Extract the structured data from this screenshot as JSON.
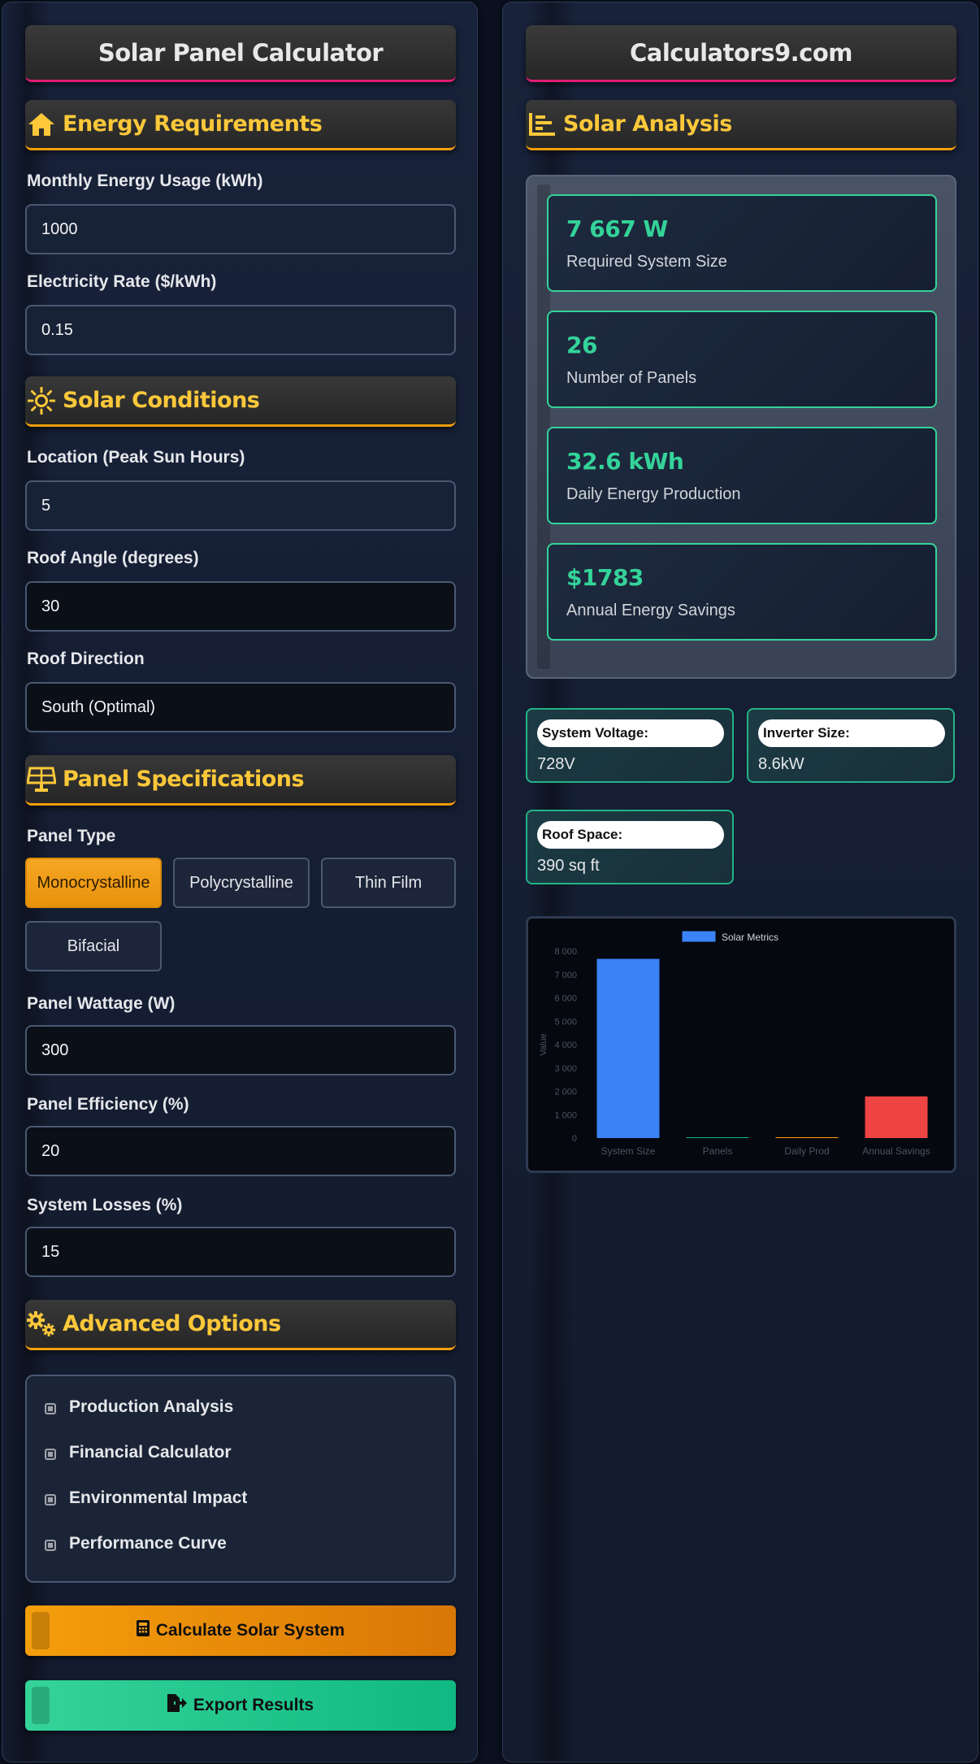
{
  "left": {
    "title": "Solar Panel Calculator",
    "sections": {
      "energy": "Energy Requirements",
      "solar": "Solar Conditions",
      "panel": "Panel Specifications",
      "advanced": "Advanced Options"
    },
    "fields": {
      "monthly_usage": {
        "label": "Monthly Energy Usage (kWh)",
        "value": "1000"
      },
      "rate": {
        "label": "Electricity Rate ($/kWh)",
        "value": "0.15"
      },
      "sun_hours": {
        "label": "Location (Peak Sun Hours)",
        "value": "5"
      },
      "roof_angle": {
        "label": "Roof Angle (degrees)",
        "value": "30"
      },
      "roof_direction": {
        "label": "Roof Direction",
        "value": "South (Optimal)"
      },
      "panel_type_label": "Panel Type",
      "panel_wattage": {
        "label": "Panel Wattage (W)",
        "value": "300"
      },
      "panel_efficiency": {
        "label": "Panel Efficiency (%)",
        "value": "20"
      },
      "system_losses": {
        "label": "System Losses (%)",
        "value": "15"
      }
    },
    "panel_types": [
      "Monocrystalline",
      "Polycrystalline",
      "Thin Film",
      "Bifacial"
    ],
    "panel_type_selected": "Monocrystalline",
    "advanced_options": [
      "Production Analysis",
      "Financial Calculator",
      "Environmental Impact",
      "Performance Curve"
    ],
    "buttons": {
      "calculate": "Calculate Solar System",
      "export": "Export Results"
    }
  },
  "right": {
    "title": "Calculators9.com",
    "section": "Solar Analysis",
    "results": [
      {
        "value": "7 667 W",
        "caption": "Required System Size"
      },
      {
        "value": "26",
        "caption": "Number of Panels"
      },
      {
        "value": "32.6 kWh",
        "caption": "Daily Energy Production"
      },
      {
        "value": "$1783",
        "caption": "Annual Energy Savings"
      }
    ],
    "info": [
      {
        "label": "System Voltage:",
        "value": "728V"
      },
      {
        "label": "Inverter Size:",
        "value": "8.6kW"
      },
      {
        "label": "Roof Space:",
        "value": "390 sq ft"
      }
    ]
  },
  "colors": {
    "accent": "#f59e0b",
    "green": "#34d399",
    "title_underline": "#e11d74",
    "section_text": "#fcc83a",
    "bar_blue": "#3b82f6",
    "bar_red": "#ef4444"
  },
  "chart_data": {
    "type": "bar",
    "legend": "Solar Metrics",
    "legend_position": "top",
    "categories": [
      "System Size",
      "Panels",
      "Daily Prod",
      "Annual Savings"
    ],
    "series": [
      {
        "name": "Solar Metrics",
        "values": [
          7667,
          26,
          32.6,
          1783
        ]
      }
    ],
    "bar_colors": [
      "#3b82f6",
      "#10b981",
      "#f59e0b",
      "#ef4444"
    ],
    "ylabel": "Value",
    "ylim": [
      0,
      8000
    ],
    "yticks": [
      "0",
      "1 000",
      "2 000",
      "3 000",
      "4 000",
      "5 000",
      "6 000",
      "7 000",
      "8 000"
    ],
    "grid": false
  }
}
